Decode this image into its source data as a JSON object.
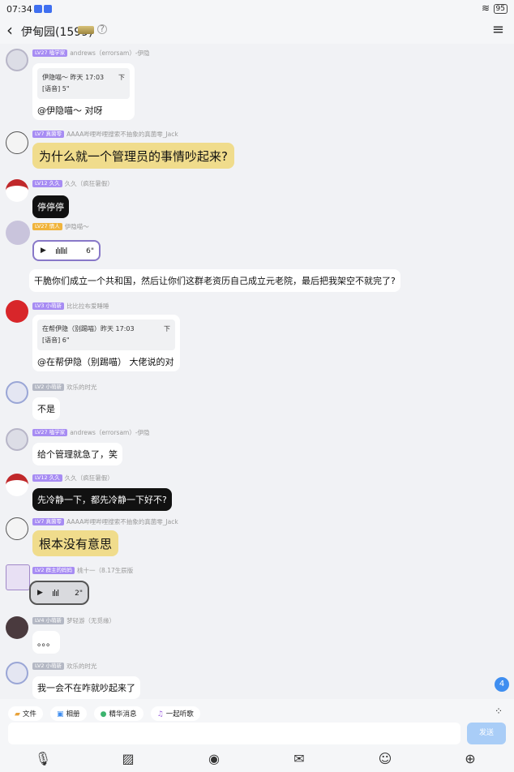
{
  "status": {
    "time": "07:34",
    "battery": "95"
  },
  "header": {
    "title": "伊甸园(1599)"
  },
  "messages": [
    {
      "level": "LV27 嗑学家",
      "name": "andrews（errorsam）-伊隐",
      "quote_title": "伊隐喵～ 昨天 17:03",
      "quote_sub": "[语音] 5\"",
      "quote_dl": "下",
      "text": "@伊隐喵～ 对呀"
    },
    {
      "level": "LV7 真菌零",
      "name": "AAAA哔哩哔哩搜索不抽象的真菌零_Jack",
      "text": "为什么就一个管理员的事情吵起来?"
    },
    {
      "level": "LV12 久久",
      "name": "久久（疯狂暑假）",
      "text": "停停停"
    },
    {
      "level": "LV27 情人",
      "name": "伊隐喵～",
      "voice_duration": "6\"",
      "text": "干脆你们成立一个共和国，然后让你们这群老资历自己成立元老院，最后把我架空不就完了?"
    },
    {
      "level": "LV3 小萌新",
      "name": "比比拉布爱睡睡",
      "quote_title": "在帮伊隐（别踢喵）昨天 17:03",
      "quote_sub": "[语音] 6\"",
      "quote_dl": "下",
      "text": "@在帮伊隐（别踢喵） 大佬说的对"
    },
    {
      "level": "LV2 小萌新",
      "name": "欢乐的时光",
      "text": "不是"
    },
    {
      "level": "LV27 嗑学家",
      "name": "andrews（errorsam）-伊隐",
      "text": "给个管理就急了，笑"
    },
    {
      "level": "LV12 久久",
      "name": "久久（疯狂暑假）",
      "text": "先冷静一下，都先冷静一下好不?"
    },
    {
      "level": "LV7 真菌零",
      "name": "AAAA哔哩哔哩搜索不抽象的真菌零_Jack",
      "text": "根本没有意思"
    },
    {
      "level": "LV2 群主的妈妈",
      "name": "桃十一（8.17生辰版",
      "voice_duration": "2\""
    },
    {
      "level": "LV4 小萌新",
      "name": "梦轻游（无觅缘）",
      "text": "。。。"
    },
    {
      "level": "LV2 小萌新",
      "name": "欢乐的时光",
      "text": "我一会不在咋就吵起来了"
    }
  ],
  "unread_count": "4",
  "chips": [
    "文件",
    "相册",
    "精华消息",
    "一起听歌"
  ],
  "input": {
    "placeholder": "",
    "send_label": "发送"
  },
  "icons": {
    "back": "chevron-left-icon",
    "menu": "hamburger-icon",
    "mic": "microphone-icon",
    "gallery": "image-icon",
    "camera": "camera-icon",
    "redpacket": "gift-icon",
    "emoji": "emoji-icon",
    "plus": "plus-icon"
  },
  "colors": {
    "accent": "#3f8ef0",
    "send": "#a9cdf7",
    "level": "#a78cf3",
    "yellow_bubble": "#f0dc8c"
  }
}
